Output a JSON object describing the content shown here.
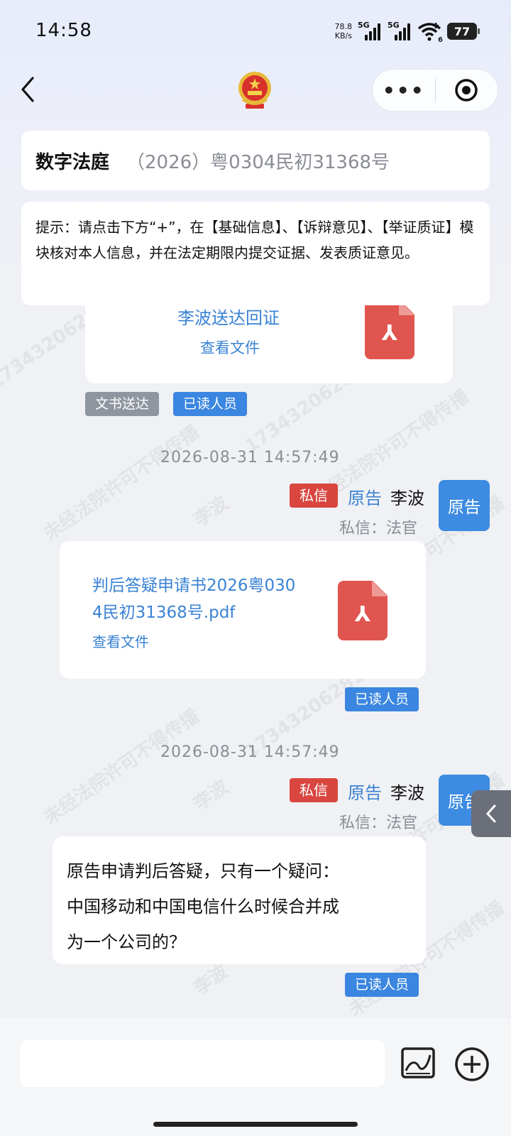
{
  "status_bar": {
    "time": "14:58",
    "net_speed_value": "78.8",
    "net_speed_unit": "KB/s",
    "signal_1_label": "5G",
    "signal_2_label": "5G",
    "wifi_badge": "6",
    "battery": "77"
  },
  "nav": {
    "more_label": "•••"
  },
  "header": {
    "title": "数字法庭",
    "case_number": "（2026）粤0304民初31368号"
  },
  "tip": {
    "text": "提示：请点击下方“+”，在【基础信息】、【诉辩意见】、【举证质证】模块核对本人信息，并在法定期限内提交证据、发表质证意见。"
  },
  "watermark": {
    "text": "未经法院许可不得传播",
    "name": "李波",
    "number": "17343206281"
  },
  "messages": [
    {
      "type": "file",
      "file_name": "李波送达回证",
      "view_label": "查看文件",
      "tags": [
        "文书送达",
        "已读人员"
      ]
    },
    {
      "type": "file",
      "timestamp": "2026-08-31 14:57:49",
      "badge": "私信",
      "sender_role": "原告",
      "sender_name": "李波",
      "recipient": "私信：法官",
      "avatar_label": "原告",
      "file_name_line1": "判后答疑申请书2026粤030",
      "file_name_line2": "4民初31368号.pdf",
      "view_label": "查看文件",
      "read_label": "已读人员"
    },
    {
      "type": "text",
      "timestamp": "2026-08-31 14:57:49",
      "badge": "私信",
      "sender_role": "原告",
      "sender_name": "李波",
      "recipient": "私信：法官",
      "avatar_label": "原告",
      "text_lines": [
        "原告申请判后答疑，只有一个疑问：",
        "中国移动和中国电信什么时候合并成",
        "为一个公司的？"
      ],
      "read_label": "已读人员"
    }
  ],
  "colors": {
    "link_blue": "#3a82d4",
    "tag_blue": "#3a86e0",
    "tag_red": "#d8463f",
    "tag_gray": "#8f969f",
    "avatar_blue": "#3d8be2",
    "pdf_red": "#e0554f"
  },
  "icons": {
    "back": "chevron-left-icon",
    "emblem": "national-emblem-icon",
    "more": "more-dots-icon",
    "record": "record-target-icon",
    "pdf": "pdf-file-icon",
    "side_tab": "chevron-left-icon",
    "image": "image-icon",
    "add": "plus-circle-icon"
  }
}
